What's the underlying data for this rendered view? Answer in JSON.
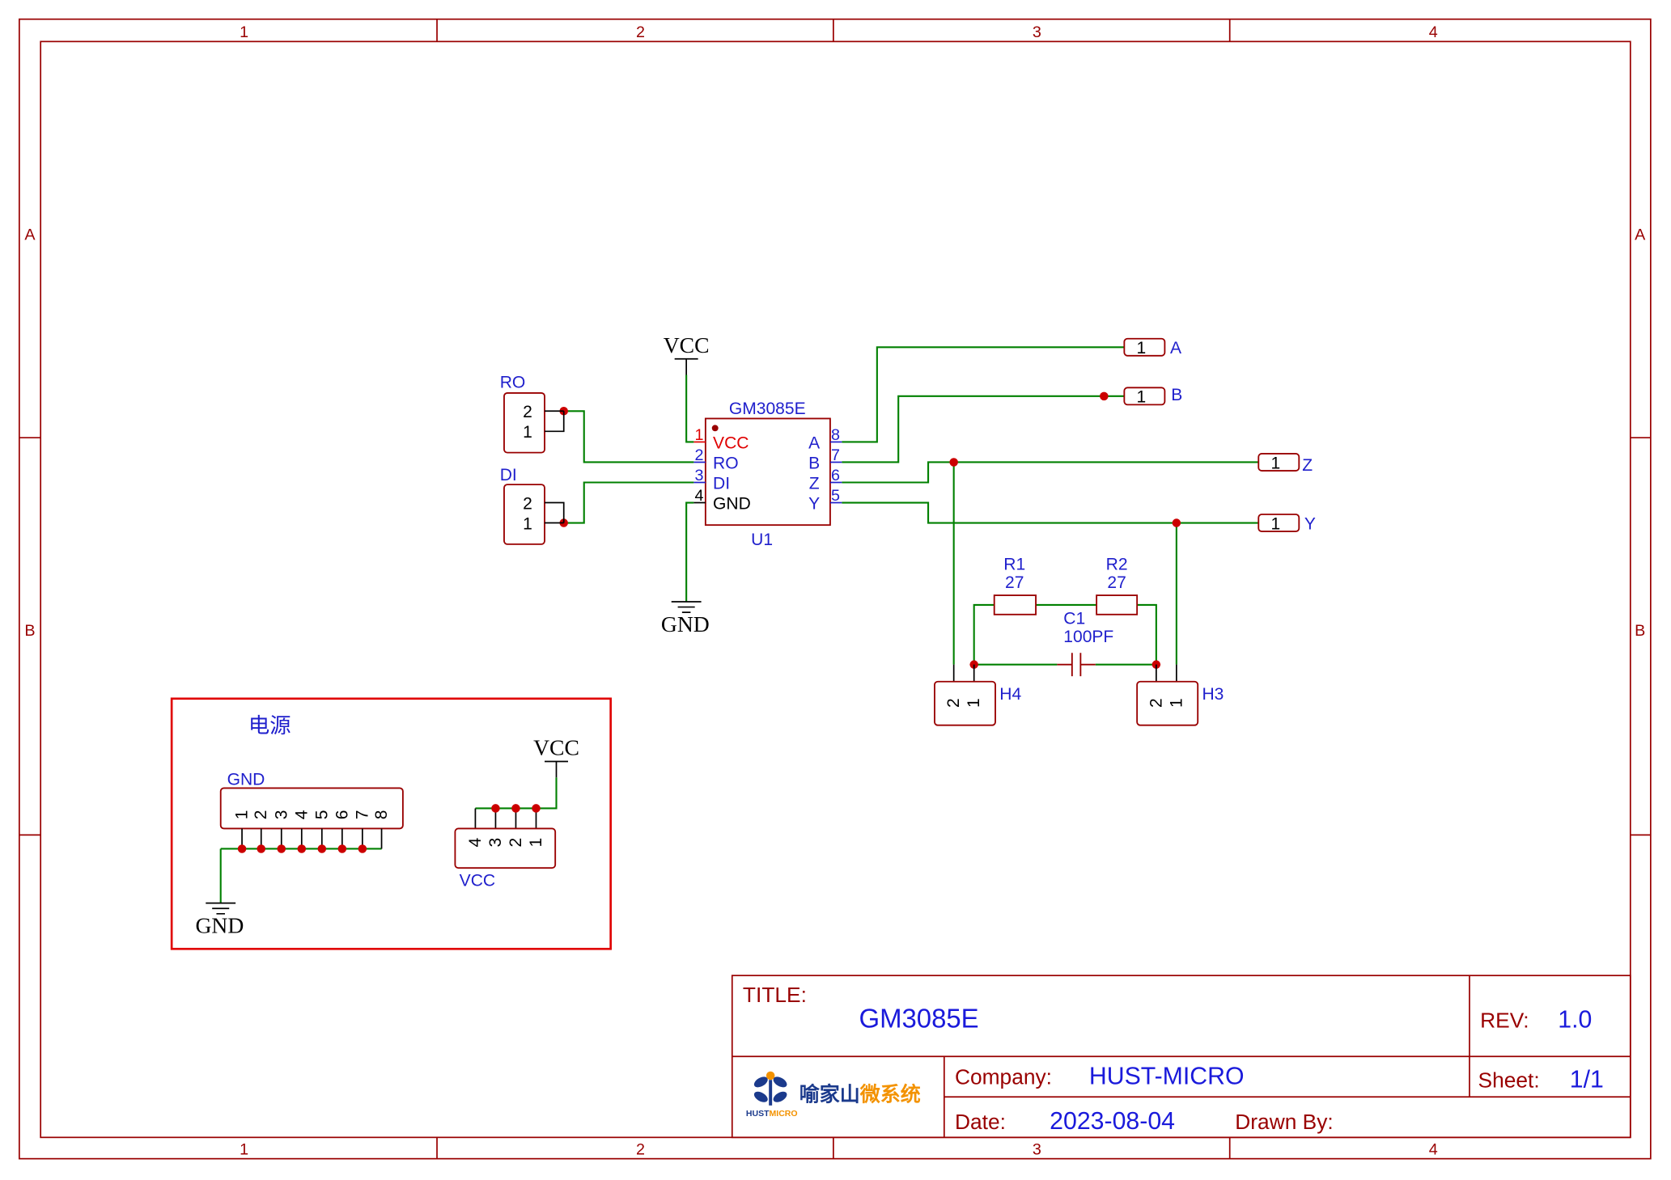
{
  "sheet": {
    "column_labels": [
      "1",
      "2",
      "3",
      "4"
    ],
    "row_labels": [
      "A",
      "B"
    ]
  },
  "colors": {
    "frame": "#990000",
    "wire": "#008000",
    "junction": "#cc0000",
    "text_blue": "#1f1fcc",
    "title_blue": "#1a1adb",
    "pin_red": "#e00000",
    "power_box": "#e00000",
    "logo_blue": "#1b3a8c",
    "logo_orange": "#f39200"
  },
  "power_symbols": {
    "vcc": "VCC",
    "gnd": "GND"
  },
  "u1": {
    "part": "GM3085E",
    "designator": "U1",
    "left_pins": [
      {
        "number": "1",
        "name": "VCC"
      },
      {
        "number": "2",
        "name": "RO"
      },
      {
        "number": "3",
        "name": "DI"
      },
      {
        "number": "4",
        "name": "GND"
      }
    ],
    "right_pins": [
      {
        "number": "8",
        "name": "A"
      },
      {
        "number": "7",
        "name": "B"
      },
      {
        "number": "6",
        "name": "Z"
      },
      {
        "number": "5",
        "name": "Y"
      }
    ]
  },
  "headers": {
    "ro": {
      "label": "RO",
      "pins": [
        "2",
        "1"
      ]
    },
    "di": {
      "label": "DI",
      "pins": [
        "2",
        "1"
      ]
    },
    "h4": {
      "label": "H4",
      "pins": [
        "2",
        "1"
      ]
    },
    "h3": {
      "label": "H3",
      "pins": [
        "2",
        "1"
      ]
    }
  },
  "net_ports": {
    "a": {
      "pin": "1",
      "net": "A"
    },
    "b": {
      "pin": "1",
      "net": "B"
    },
    "z": {
      "pin": "1",
      "net": "Z"
    },
    "y": {
      "pin": "1",
      "net": "Y"
    }
  },
  "passives": {
    "r1": {
      "designator": "R1",
      "value": "27"
    },
    "r2": {
      "designator": "R2",
      "value": "27"
    },
    "c1": {
      "designator": "C1",
      "value": "100PF"
    }
  },
  "power_section": {
    "title": "电源",
    "gnd_header": {
      "label": "GND",
      "pins": [
        "1",
        "2",
        "3",
        "4",
        "5",
        "6",
        "7",
        "8"
      ]
    },
    "vcc_header": {
      "label": "VCC",
      "pins": [
        "4",
        "3",
        "2",
        "1"
      ]
    }
  },
  "title_block": {
    "title_label": "TITLE:",
    "title": "GM3085E",
    "rev_label": "REV:",
    "rev": "1.0",
    "company_label": "Company:",
    "company": "HUST-MICRO",
    "sheet_label": "Sheet:",
    "sheet": "1/1",
    "date_label": "Date:",
    "date": "2023-08-04",
    "drawn_by_label": "Drawn By:",
    "logo": {
      "icon": "hust-micro-flower-logo",
      "name_part1": "喻家山",
      "name_part2": "微系统",
      "sub_part1": "HUST",
      "sub_part2": "MICRO"
    }
  }
}
